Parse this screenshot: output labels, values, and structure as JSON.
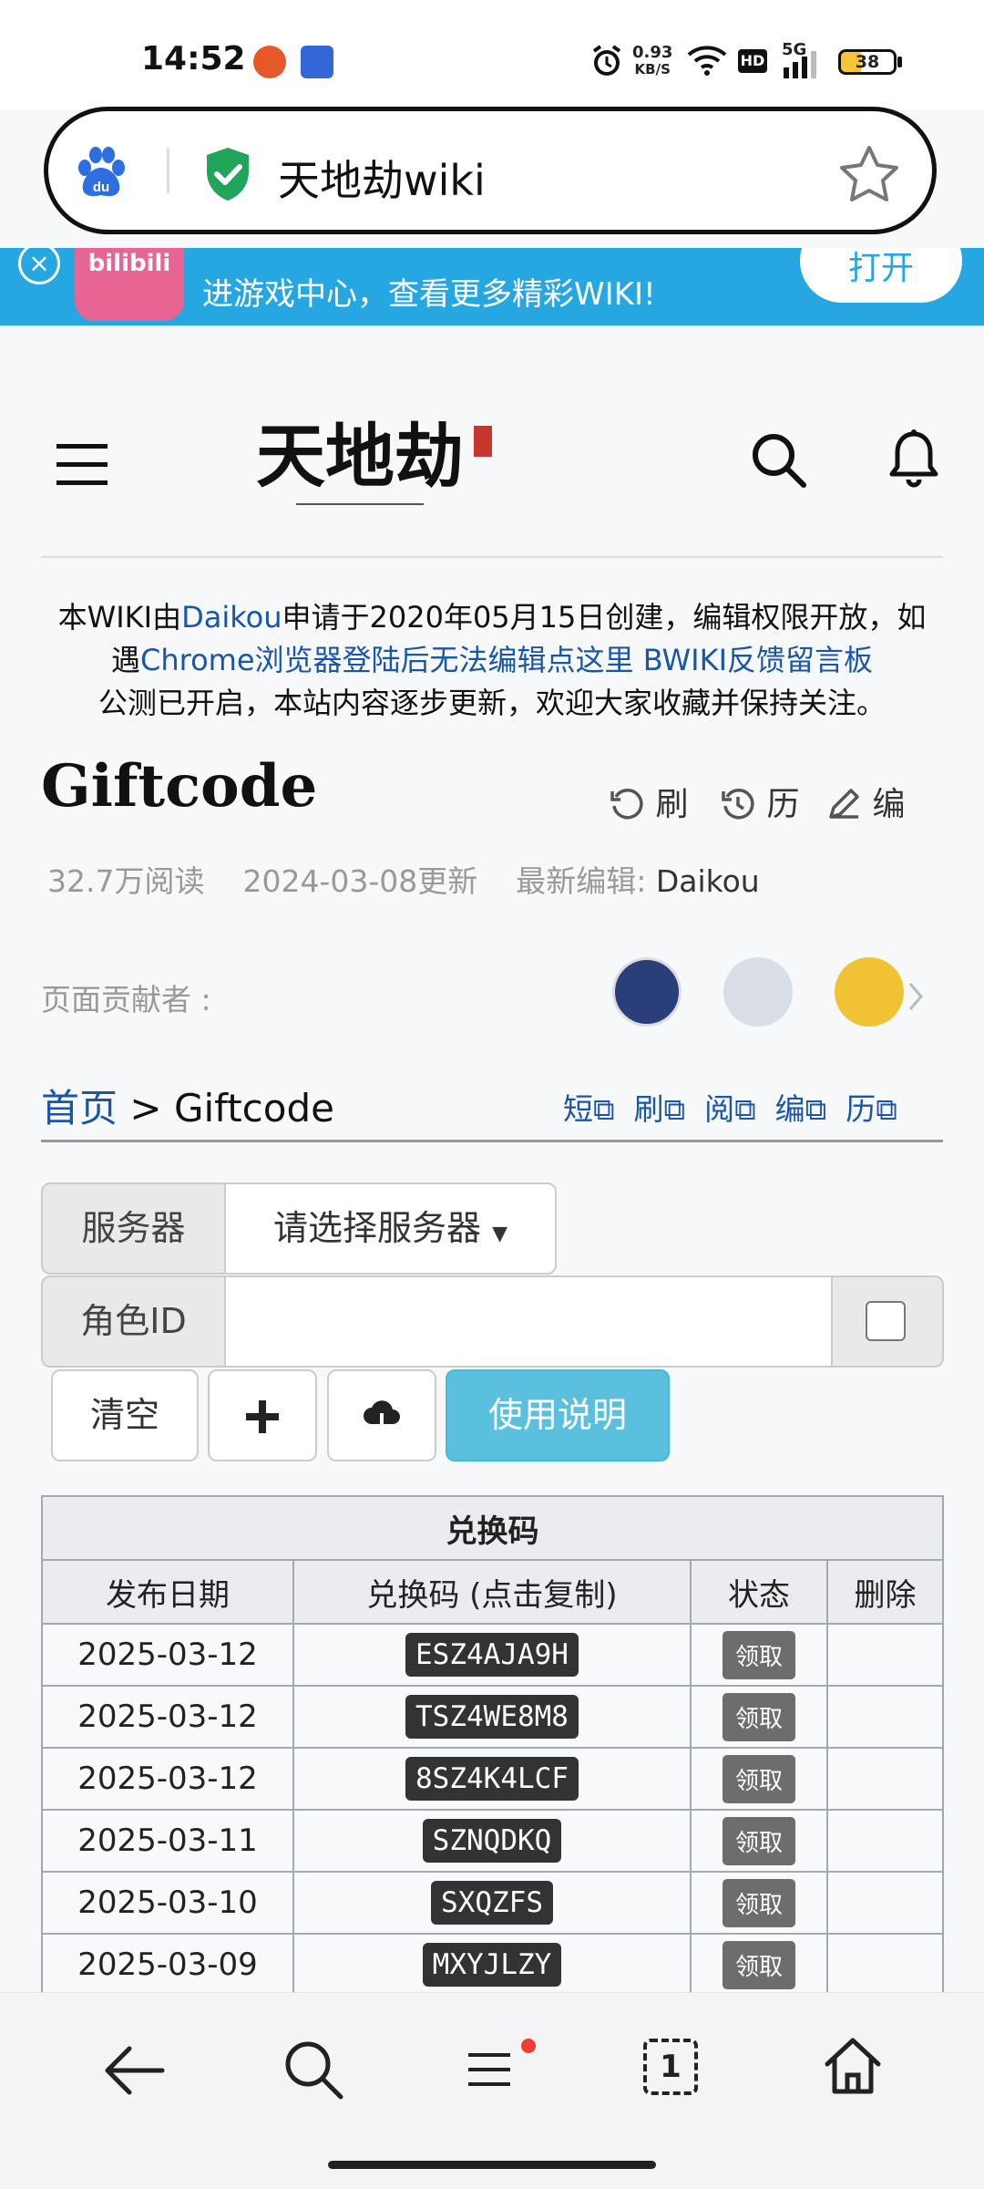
{
  "status_bar": {
    "time": "14:52",
    "net_speed_value": "0.93",
    "net_speed_unit": "KB/S",
    "network": "5G",
    "hd": "HD",
    "battery": "38",
    "icons": [
      "alarm-icon",
      "wifi-icon",
      "signal-icon",
      "battery-icon"
    ]
  },
  "address_bar": {
    "title": "天地劫wiki",
    "icons": [
      "baidu-logo-icon",
      "secure-shield-icon",
      "bookmark-star-icon"
    ]
  },
  "banner": {
    "text": "进游戏中心，查看更多精彩WIKI!",
    "open_label": "打开",
    "app_label": "bilibili"
  },
  "header": {
    "logo_alt": "天地劫"
  },
  "notice": {
    "line1_a": "本WIKI由",
    "line1_link": "Daikou",
    "line1_b": "申请于2020年05月15日创建，编辑权限开放，如",
    "line2_a": "遇",
    "line2_link1": "Chrome浏览器登陆后无法编辑点这里",
    "line2_link2": "BWIKI反馈留言板",
    "line3": "公测已开启，本站内容逐步更新，欢迎大家收藏并保持关注。"
  },
  "page": {
    "title": "Giftcode",
    "tools": {
      "refresh": "刷",
      "history": "历",
      "edit": "编"
    },
    "views": "32.7万阅读",
    "updated": "2024-03-08更新",
    "last_editor_label": "最新编辑:",
    "last_editor": "Daikou",
    "contributors_label": "页面贡献者 :"
  },
  "breadcrumb": {
    "home": "首页",
    "sep": ">",
    "current": "Giftcode",
    "links": [
      "短",
      "刷",
      "阅",
      "编",
      "历"
    ]
  },
  "form": {
    "server_label": "服务器",
    "server_select": "请选择服务器",
    "role_label": "角色ID",
    "role_value": "",
    "clear": "清空",
    "usage": "使用说明"
  },
  "table": {
    "caption": "兑换码",
    "headers": [
      "发布日期",
      "兑换码 (点击复制)",
      "状态",
      "删除"
    ],
    "claim_label": "领取",
    "rows": [
      {
        "date": "2025-03-12",
        "code": "ESZ4AJA9H"
      },
      {
        "date": "2025-03-12",
        "code": "TSZ4WE8M8"
      },
      {
        "date": "2025-03-12",
        "code": "8SZ4K4LCF"
      },
      {
        "date": "2025-03-11",
        "code": "SZNQDKQ"
      },
      {
        "date": "2025-03-10",
        "code": "SXQZFS"
      },
      {
        "date": "2025-03-09",
        "code": "MXYJLZY"
      }
    ]
  },
  "bottom_nav": {
    "tabs_count": "1",
    "icons": [
      "back-arrow-icon",
      "search-icon",
      "menu-icon",
      "tabs-icon",
      "home-icon"
    ]
  },
  "colors": {
    "banner": "#27a7e1",
    "link": "#1a56a8",
    "usage_button": "#5bc0de",
    "shield": "#21a55a",
    "code_bg": "#333333",
    "claim_bg": "#6d6d6d"
  }
}
